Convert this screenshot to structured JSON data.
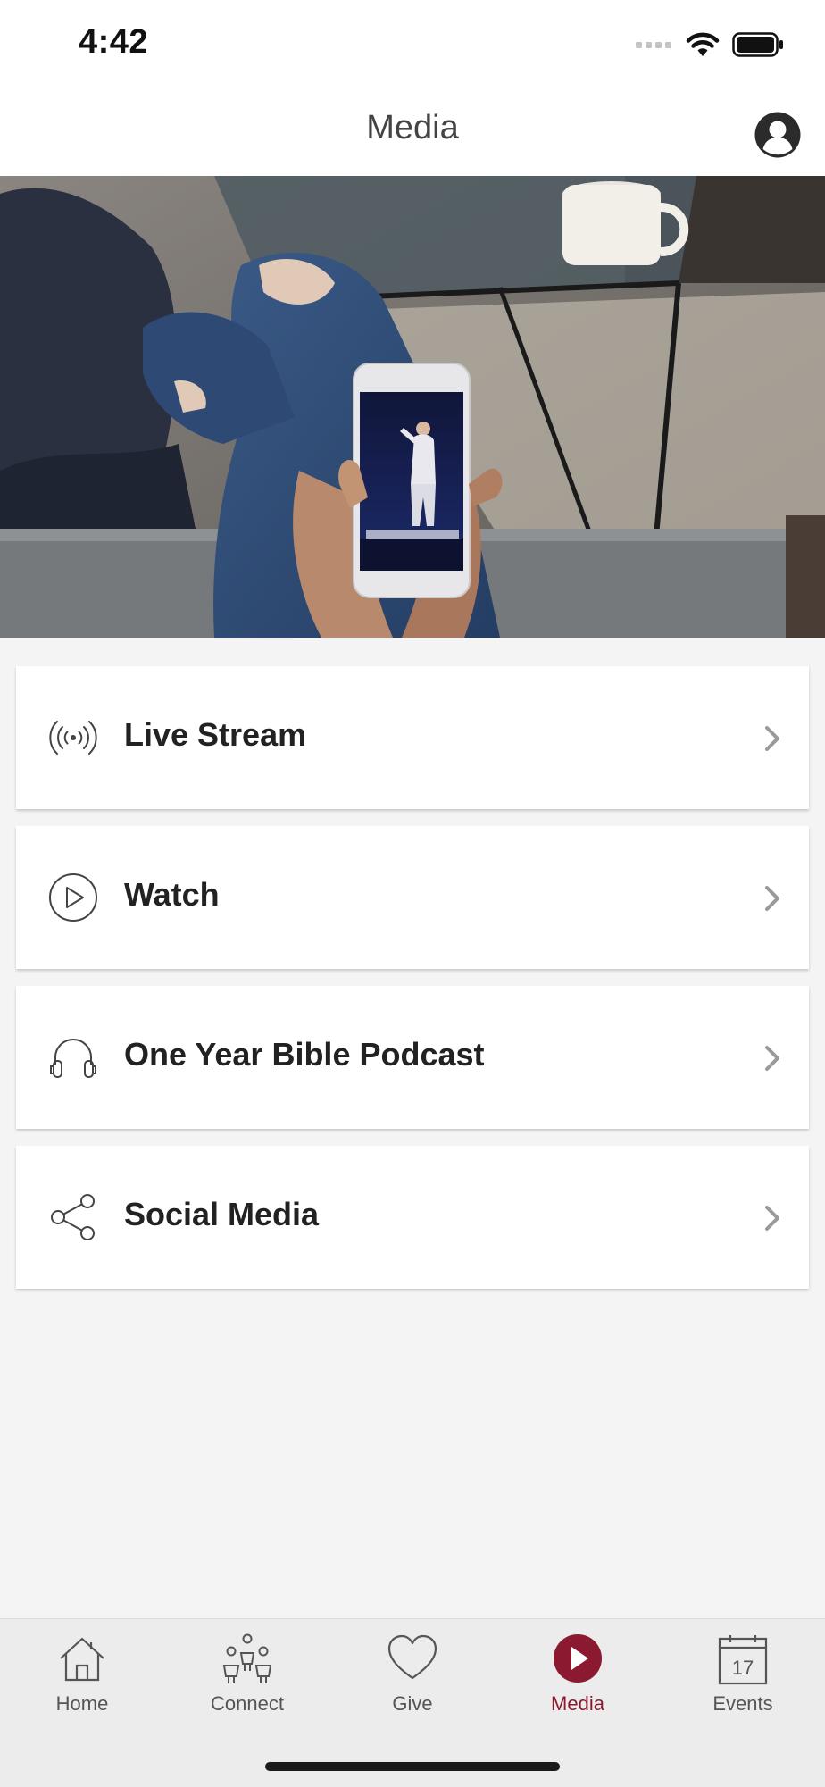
{
  "status_bar": {
    "time": "4:42"
  },
  "header": {
    "title": "Media"
  },
  "menu": {
    "items": [
      {
        "label": "Live Stream",
        "icon": "broadcast-icon"
      },
      {
        "label": "Watch",
        "icon": "play-circle-icon"
      },
      {
        "label": "One Year Bible Podcast",
        "icon": "headphones-icon"
      },
      {
        "label": "Social Media",
        "icon": "share-icon"
      }
    ]
  },
  "tab_bar": {
    "items": [
      {
        "label": "Home",
        "icon": "home-icon",
        "active": false
      },
      {
        "label": "Connect",
        "icon": "people-icon",
        "active": false
      },
      {
        "label": "Give",
        "icon": "heart-icon",
        "active": false
      },
      {
        "label": "Media",
        "icon": "media-play-icon",
        "active": true
      },
      {
        "label": "Events",
        "icon": "calendar-icon",
        "active": false,
        "calendar_day": "17"
      }
    ]
  },
  "colors": {
    "accent": "#8b1a30",
    "background": "#f4f4f4"
  }
}
